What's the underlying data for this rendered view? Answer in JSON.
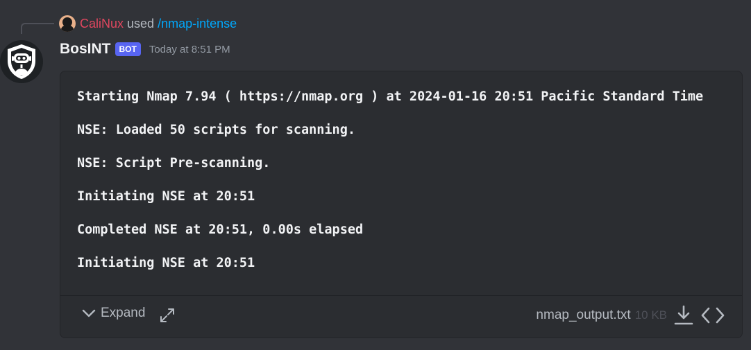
{
  "reply": {
    "username": "CaliNux",
    "used_text": "used",
    "command": "/nmap-intense",
    "colors": {
      "username": "#e0475f",
      "command": "#00a8fc"
    }
  },
  "message": {
    "author": "BosINT",
    "badge": "BOT",
    "timestamp": "Today at 8:51 PM",
    "avatar_icon": "robot-shield-icon"
  },
  "attachment": {
    "lines": [
      "Starting Nmap 7.94 ( https://nmap.org ) at 2024-01-16 20:51 Pacific Standard Time",
      "NSE: Loaded 50 scripts for scanning.",
      "NSE: Script Pre-scanning.",
      "Initiating NSE at 20:51",
      "Completed NSE at 20:51, 0.00s elapsed",
      "Initiating NSE at 20:51"
    ],
    "expand_label": "Expand",
    "file_name": "nmap_output.txt",
    "file_size": "10 KB"
  },
  "theme": {
    "background": "#313338",
    "embed_background": "#2b2d31",
    "bot_badge": "#5865f2"
  }
}
